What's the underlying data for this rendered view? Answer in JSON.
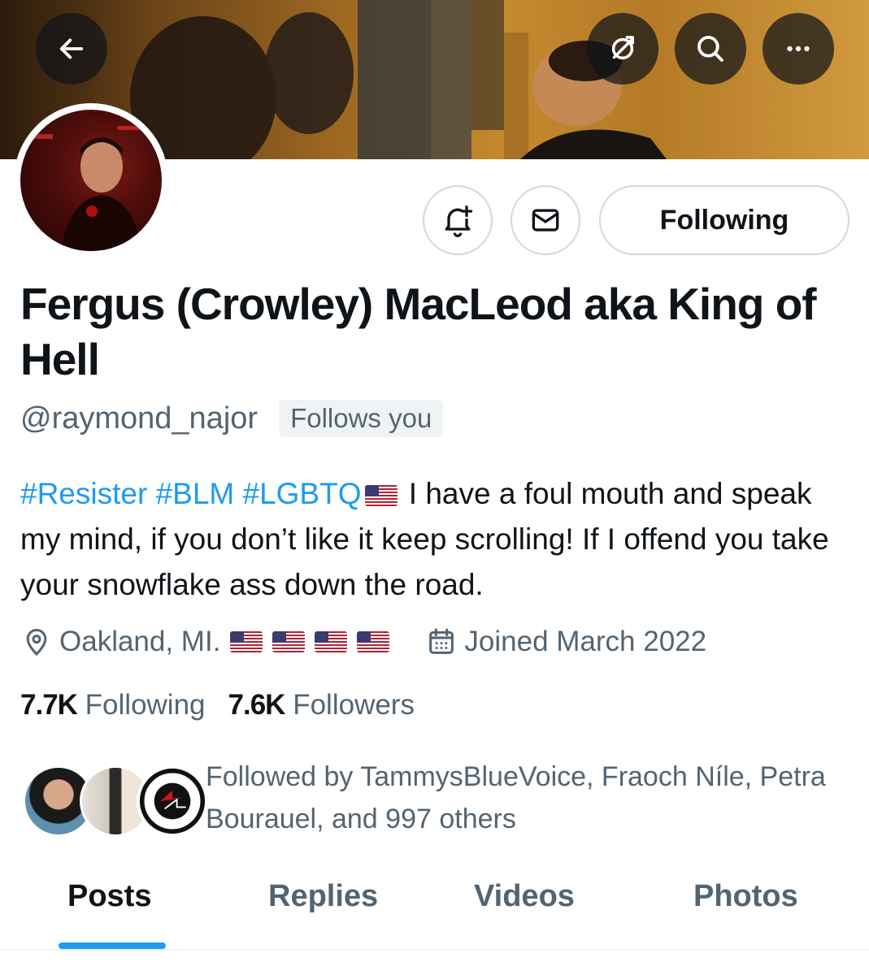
{
  "profile": {
    "name": "Fergus (Crowley) MacLeod aka King of Hell",
    "handle": "@raymond_najor",
    "follows_you": "Follows you",
    "bio": {
      "hashtags": [
        "#Resister",
        "#BLM",
        "#LGBTQ"
      ],
      "text": " I have a foul mouth and speak my mind, if you don’t like it keep scrolling! If I offend you take your snowflake ass down the road."
    },
    "location": "Oakland, MI.",
    "joined": "Joined March 2022",
    "following_count": "7.7K",
    "following_label": "Following",
    "followers_count": "7.6K",
    "followers_label": "Followers",
    "followed_by": "Followed by TammysBlueVoice, Fraoch Níle, Petra Bourauel, and 997 others"
  },
  "actions": {
    "following_button": "Following"
  },
  "tabs": [
    {
      "label": "Posts"
    },
    {
      "label": "Replies"
    },
    {
      "label": "Videos"
    },
    {
      "label": "Photos"
    }
  ],
  "icons": {
    "back": "arrow-left-icon",
    "translate": "globe-off-icon",
    "search": "search-icon",
    "more": "more-icon",
    "notify": "bell-plus-icon",
    "message": "envelope-icon",
    "location": "location-pin-icon",
    "calendar": "calendar-icon"
  },
  "colors": {
    "accent": "#1d9bf0",
    "text_primary": "#0f1419",
    "text_secondary": "#536471",
    "border": "#cfd9de"
  }
}
